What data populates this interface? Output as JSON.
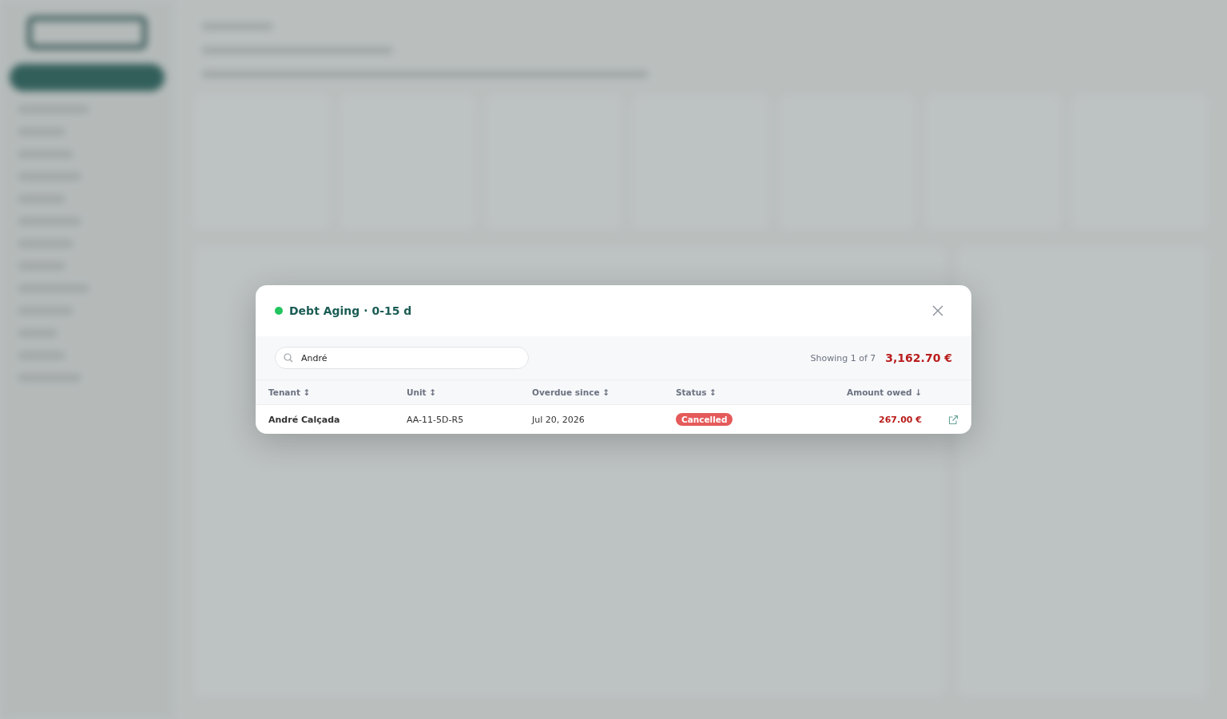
{
  "modal": {
    "title": "Debt Aging · 0-15 d",
    "search": {
      "value": "André"
    },
    "showing": "Showing 1 of 7",
    "total": "3,162.70 €",
    "columns": [
      {
        "label": "Tenant",
        "sort_icon": "↕"
      },
      {
        "label": "Unit",
        "sort_icon": "↕"
      },
      {
        "label": "Overdue since",
        "sort_icon": "↕"
      },
      {
        "label": "Status",
        "sort_icon": "↕"
      },
      {
        "label": "Amount owed",
        "sort_icon": "↓"
      }
    ],
    "rows": [
      {
        "tenant": "André Calçada",
        "unit": "AA-11-5D-R5",
        "overdue_since": "Jul 20, 2026",
        "status": {
          "label": "Cancelled",
          "color": "#e55a5a"
        },
        "amount": "267.00 €"
      }
    ]
  }
}
